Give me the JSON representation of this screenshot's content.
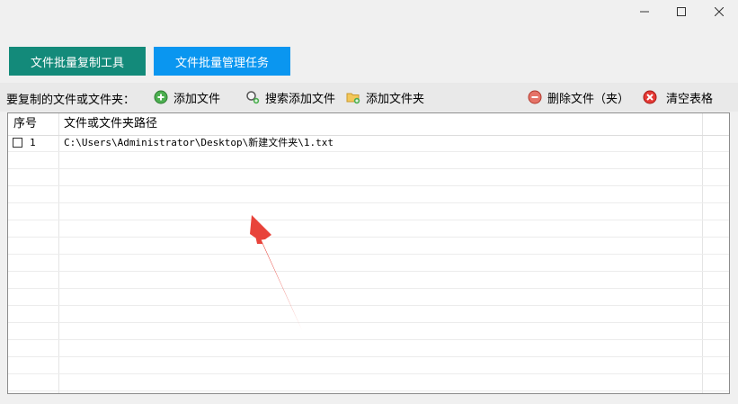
{
  "window": {
    "minimize_icon": "minimize-icon",
    "maximize_icon": "maximize-icon",
    "close_icon": "close-icon"
  },
  "tabs": [
    {
      "label": "文件批量复制工具",
      "color": "#138a7a"
    },
    {
      "label": "文件批量管理任务",
      "color": "#0a96f0"
    }
  ],
  "toolbar": {
    "label": "要复制的文件或文件夹：",
    "add_file": "添加文件",
    "search_add_file": "搜索添加文件",
    "add_folder": "添加文件夹",
    "delete_file": "删除文件（夹）",
    "clear_table": "清空表格"
  },
  "table": {
    "columns": [
      "序号",
      "文件或文件夹路径"
    ],
    "rows": [
      {
        "index": "1",
        "path": "C:\\Users\\Administrator\\Desktop\\新建文件夹\\1.txt",
        "checked": false
      }
    ]
  },
  "annotation": {
    "type": "arrow",
    "color": "#e8433a"
  }
}
